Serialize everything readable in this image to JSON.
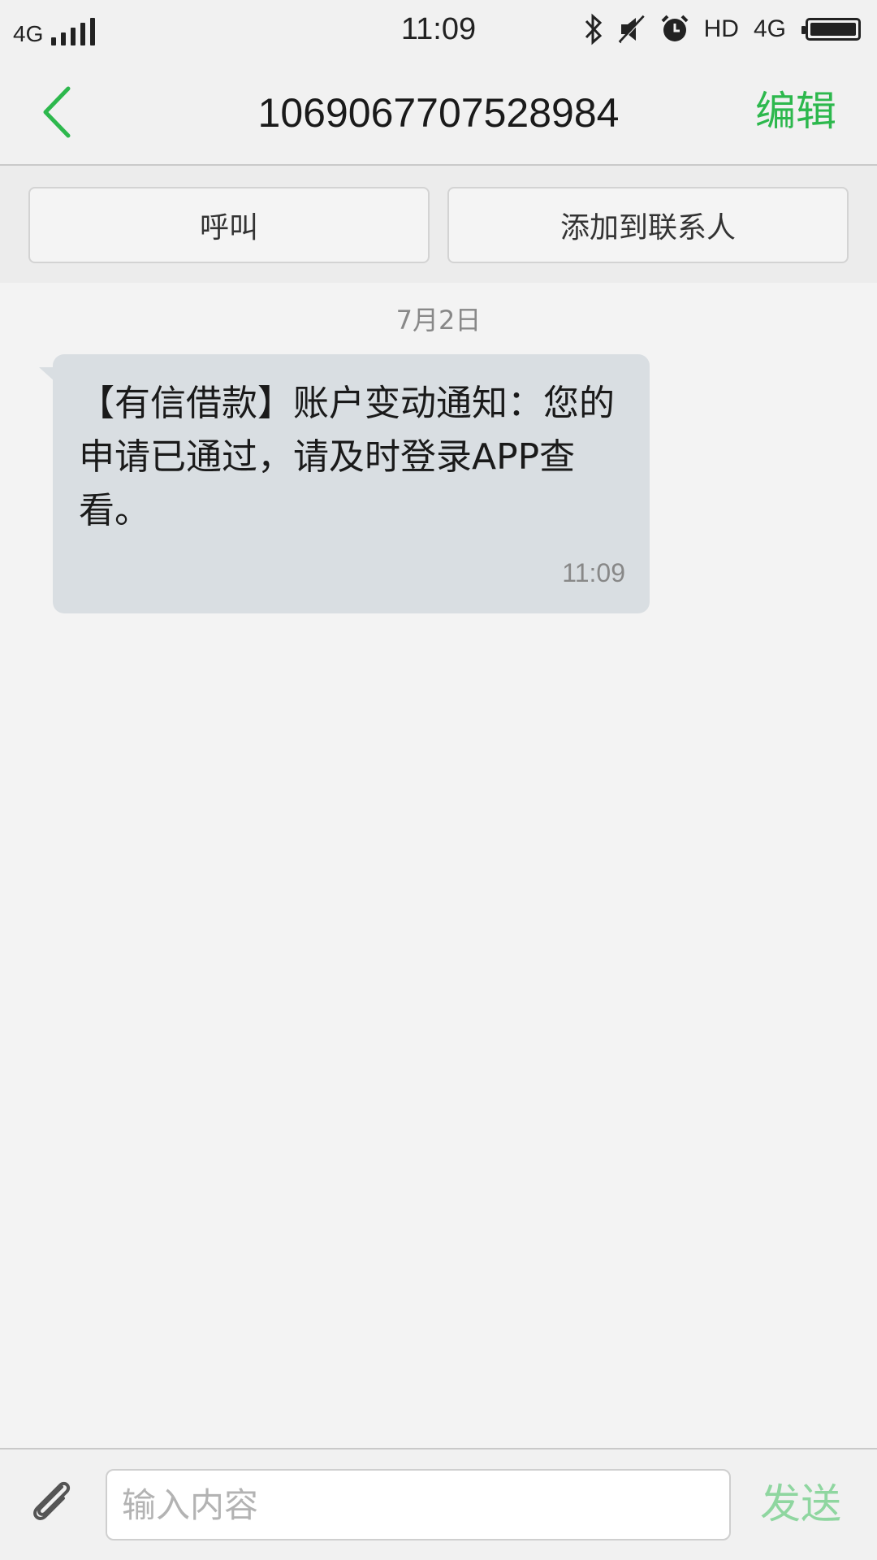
{
  "status_bar": {
    "network_left": "4G",
    "time": "11:09",
    "hd": "HD",
    "network_right": "4G",
    "icons": [
      "bluetooth-icon",
      "mute-icon",
      "alarm-icon",
      "battery-icon"
    ]
  },
  "nav": {
    "title": "1069067707528984",
    "edit_label": "编辑",
    "accent_color": "#2db84d"
  },
  "actions": {
    "call_label": "呼叫",
    "add_contact_label": "添加到联系人"
  },
  "conversation": {
    "date": "7月2日",
    "messages": [
      {
        "text": "【有信借款】账户变动通知：您的申请已通过，请及时登录APP查看。",
        "time": "11:09"
      }
    ]
  },
  "composer": {
    "placeholder": "输入内容",
    "send_label": "发送",
    "send_color": "#8fd6a0"
  }
}
